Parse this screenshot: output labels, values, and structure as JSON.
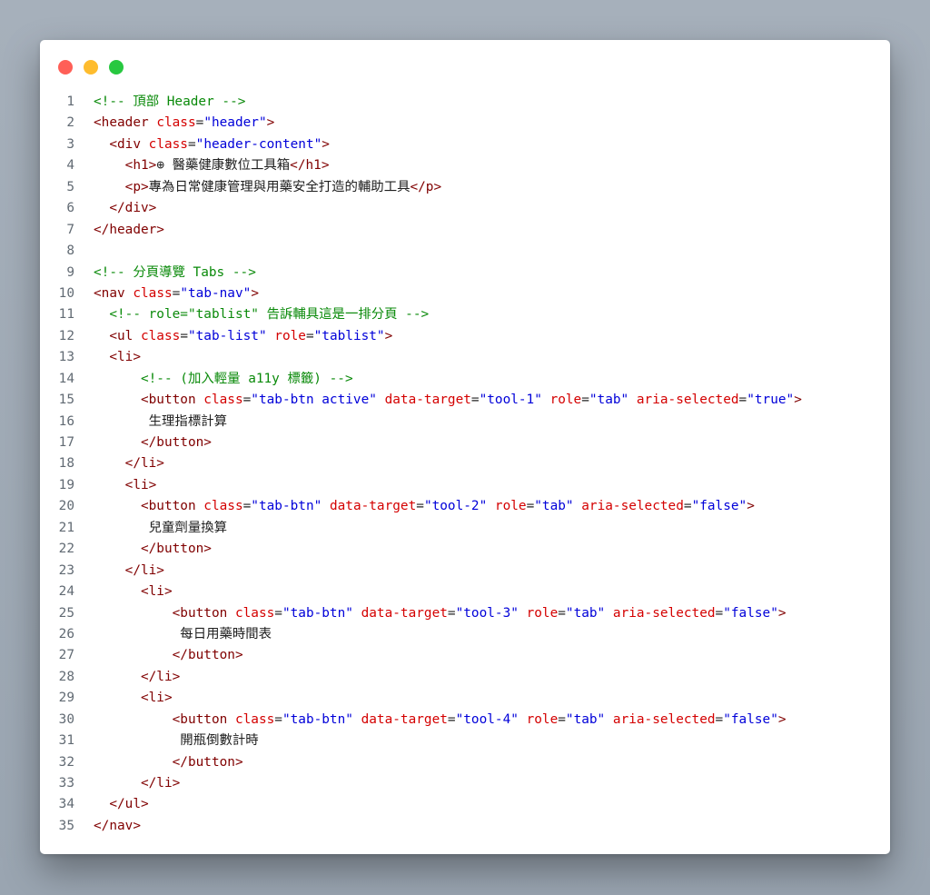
{
  "window": {
    "traffic_lights": [
      {
        "name": "close",
        "color": "#ff5f57"
      },
      {
        "name": "minimize",
        "color": "#febc2e"
      },
      {
        "name": "zoom",
        "color": "#28c840"
      }
    ]
  },
  "colors": {
    "comment": "#0a8a0a",
    "tag": "#800000",
    "attribute": "#d40000",
    "string": "#0000d9",
    "text": "#202020",
    "line_number": "#616a73"
  },
  "code_lines": [
    {
      "n": "1",
      "tokens": [
        [
          "cm",
          "<!-- 頂部 Header -->"
        ]
      ]
    },
    {
      "n": "2",
      "tokens": [
        [
          "tg",
          "<header "
        ],
        [
          "at",
          "class"
        ],
        [
          "pl",
          "="
        ],
        [
          "st",
          "\"header\""
        ],
        [
          "tg",
          ">"
        ]
      ]
    },
    {
      "n": "3",
      "tokens": [
        [
          "pl",
          "  "
        ],
        [
          "tg",
          "<div "
        ],
        [
          "at",
          "class"
        ],
        [
          "pl",
          "="
        ],
        [
          "st",
          "\"header-content\""
        ],
        [
          "tg",
          ">"
        ]
      ]
    },
    {
      "n": "4",
      "tokens": [
        [
          "pl",
          "    "
        ],
        [
          "tg",
          "<h1>"
        ],
        [
          "pl",
          "⊕ 醫藥健康數位工具箱"
        ],
        [
          "tg",
          "</h1>"
        ]
      ]
    },
    {
      "n": "5",
      "tokens": [
        [
          "pl",
          "    "
        ],
        [
          "tg",
          "<p>"
        ],
        [
          "pl",
          "專為日常健康管理與用藥安全打造的輔助工具"
        ],
        [
          "tg",
          "</p>"
        ]
      ]
    },
    {
      "n": "6",
      "tokens": [
        [
          "pl",
          "  "
        ],
        [
          "tg",
          "</div>"
        ]
      ]
    },
    {
      "n": "7",
      "tokens": [
        [
          "tg",
          "</header>"
        ]
      ]
    },
    {
      "n": "8",
      "tokens": []
    },
    {
      "n": "9",
      "tokens": [
        [
          "cm",
          "<!-- 分頁導覽 Tabs -->"
        ]
      ]
    },
    {
      "n": "10",
      "tokens": [
        [
          "tg",
          "<nav "
        ],
        [
          "at",
          "class"
        ],
        [
          "pl",
          "="
        ],
        [
          "st",
          "\"tab-nav\""
        ],
        [
          "tg",
          ">"
        ]
      ]
    },
    {
      "n": "11",
      "tokens": [
        [
          "pl",
          "  "
        ],
        [
          "cm",
          "<!-- role=\"tablist\" 告訴輔具這是一排分頁 -->"
        ]
      ]
    },
    {
      "n": "12",
      "tokens": [
        [
          "pl",
          "  "
        ],
        [
          "tg",
          "<ul "
        ],
        [
          "at",
          "class"
        ],
        [
          "pl",
          "="
        ],
        [
          "st",
          "\"tab-list\""
        ],
        [
          "pl",
          " "
        ],
        [
          "at",
          "role"
        ],
        [
          "pl",
          "="
        ],
        [
          "st",
          "\"tablist\""
        ],
        [
          "tg",
          ">"
        ]
      ]
    },
    {
      "n": "13",
      "tokens": [
        [
          "pl",
          "  "
        ],
        [
          "tg",
          "<li>"
        ]
      ]
    },
    {
      "n": "14",
      "tokens": [
        [
          "pl",
          "      "
        ],
        [
          "cm",
          "<!-- (加入輕量 a11y 標籤) -->"
        ]
      ]
    },
    {
      "n": "15",
      "tokens": [
        [
          "pl",
          "      "
        ],
        [
          "tg",
          "<button "
        ],
        [
          "at",
          "class"
        ],
        [
          "pl",
          "="
        ],
        [
          "st",
          "\"tab-btn active\""
        ],
        [
          "pl",
          " "
        ],
        [
          "at",
          "data-target"
        ],
        [
          "pl",
          "="
        ],
        [
          "st",
          "\"tool-1\""
        ],
        [
          "pl",
          " "
        ],
        [
          "at",
          "role"
        ],
        [
          "pl",
          "="
        ],
        [
          "st",
          "\"tab\""
        ],
        [
          "pl",
          " "
        ],
        [
          "at",
          "aria-selected"
        ],
        [
          "pl",
          "="
        ],
        [
          "st",
          "\"true\""
        ],
        [
          "tg",
          ">"
        ]
      ]
    },
    {
      "n": "16",
      "tokens": [
        [
          "pl",
          "       生理指標計算"
        ]
      ]
    },
    {
      "n": "17",
      "tokens": [
        [
          "pl",
          "      "
        ],
        [
          "tg",
          "</button>"
        ]
      ]
    },
    {
      "n": "18",
      "tokens": [
        [
          "pl",
          "    "
        ],
        [
          "tg",
          "</li>"
        ]
      ]
    },
    {
      "n": "19",
      "tokens": [
        [
          "pl",
          "    "
        ],
        [
          "tg",
          "<li>"
        ]
      ]
    },
    {
      "n": "20",
      "tokens": [
        [
          "pl",
          "      "
        ],
        [
          "tg",
          "<button "
        ],
        [
          "at",
          "class"
        ],
        [
          "pl",
          "="
        ],
        [
          "st",
          "\"tab-btn\""
        ],
        [
          "pl",
          " "
        ],
        [
          "at",
          "data-target"
        ],
        [
          "pl",
          "="
        ],
        [
          "st",
          "\"tool-2\""
        ],
        [
          "pl",
          " "
        ],
        [
          "at",
          "role"
        ],
        [
          "pl",
          "="
        ],
        [
          "st",
          "\"tab\""
        ],
        [
          "pl",
          " "
        ],
        [
          "at",
          "aria-selected"
        ],
        [
          "pl",
          "="
        ],
        [
          "st",
          "\"false\""
        ],
        [
          "tg",
          ">"
        ]
      ]
    },
    {
      "n": "21",
      "tokens": [
        [
          "pl",
          "       兒童劑量換算"
        ]
      ]
    },
    {
      "n": "22",
      "tokens": [
        [
          "pl",
          "      "
        ],
        [
          "tg",
          "</button>"
        ]
      ]
    },
    {
      "n": "23",
      "tokens": [
        [
          "pl",
          "    "
        ],
        [
          "tg",
          "</li>"
        ]
      ]
    },
    {
      "n": "24",
      "tokens": [
        [
          "pl",
          "      "
        ],
        [
          "tg",
          "<li>"
        ]
      ]
    },
    {
      "n": "25",
      "tokens": [
        [
          "pl",
          "          "
        ],
        [
          "tg",
          "<button "
        ],
        [
          "at",
          "class"
        ],
        [
          "pl",
          "="
        ],
        [
          "st",
          "\"tab-btn\""
        ],
        [
          "pl",
          " "
        ],
        [
          "at",
          "data-target"
        ],
        [
          "pl",
          "="
        ],
        [
          "st",
          "\"tool-3\""
        ],
        [
          "pl",
          " "
        ],
        [
          "at",
          "role"
        ],
        [
          "pl",
          "="
        ],
        [
          "st",
          "\"tab\""
        ],
        [
          "pl",
          " "
        ],
        [
          "at",
          "aria-selected"
        ],
        [
          "pl",
          "="
        ],
        [
          "st",
          "\"false\""
        ],
        [
          "tg",
          ">"
        ]
      ]
    },
    {
      "n": "26",
      "tokens": [
        [
          "pl",
          "           每日用藥時間表"
        ]
      ]
    },
    {
      "n": "27",
      "tokens": [
        [
          "pl",
          "          "
        ],
        [
          "tg",
          "</button>"
        ]
      ]
    },
    {
      "n": "28",
      "tokens": [
        [
          "pl",
          "      "
        ],
        [
          "tg",
          "</li>"
        ]
      ]
    },
    {
      "n": "29",
      "tokens": [
        [
          "pl",
          "      "
        ],
        [
          "tg",
          "<li>"
        ]
      ]
    },
    {
      "n": "30",
      "tokens": [
        [
          "pl",
          "          "
        ],
        [
          "tg",
          "<button "
        ],
        [
          "at",
          "class"
        ],
        [
          "pl",
          "="
        ],
        [
          "st",
          "\"tab-btn\""
        ],
        [
          "pl",
          " "
        ],
        [
          "at",
          "data-target"
        ],
        [
          "pl",
          "="
        ],
        [
          "st",
          "\"tool-4\""
        ],
        [
          "pl",
          " "
        ],
        [
          "at",
          "role"
        ],
        [
          "pl",
          "="
        ],
        [
          "st",
          "\"tab\""
        ],
        [
          "pl",
          " "
        ],
        [
          "at",
          "aria-selected"
        ],
        [
          "pl",
          "="
        ],
        [
          "st",
          "\"false\""
        ],
        [
          "tg",
          ">"
        ]
      ]
    },
    {
      "n": "31",
      "tokens": [
        [
          "pl",
          "           開瓶倒數計時"
        ]
      ]
    },
    {
      "n": "32",
      "tokens": [
        [
          "pl",
          "          "
        ],
        [
          "tg",
          "</button>"
        ]
      ]
    },
    {
      "n": "33",
      "tokens": [
        [
          "pl",
          "      "
        ],
        [
          "tg",
          "</li>"
        ]
      ]
    },
    {
      "n": "34",
      "tokens": [
        [
          "pl",
          "  "
        ],
        [
          "tg",
          "</ul>"
        ]
      ]
    },
    {
      "n": "35",
      "tokens": [
        [
          "tg",
          "</nav>"
        ]
      ]
    }
  ]
}
